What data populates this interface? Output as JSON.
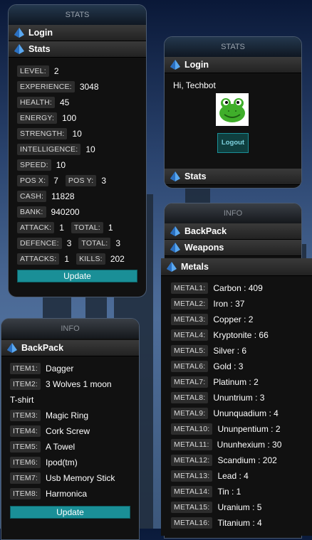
{
  "colors": {
    "accent": "#1a8f97",
    "panel": "#111111"
  },
  "stats_panel": {
    "header": "STATS",
    "login_label": "Login",
    "stats_label": "Stats",
    "level": {
      "label": "LEVEL:",
      "value": "2"
    },
    "experience": {
      "label": "EXPERIENCE:",
      "value": "3048"
    },
    "health": {
      "label": "HEALTH:",
      "value": "45"
    },
    "energy": {
      "label": "ENERGY:",
      "value": "100"
    },
    "strength": {
      "label": "STRENGTH:",
      "value": "10"
    },
    "intelligence": {
      "label": "INTELLIGENCE:",
      "value": "10"
    },
    "speed": {
      "label": "SPEED:",
      "value": "10"
    },
    "posx": {
      "label": "POS X:",
      "value": "7"
    },
    "posy": {
      "label": "POS Y:",
      "value": "3"
    },
    "cash": {
      "label": "CASH:",
      "value": "11828"
    },
    "bank": {
      "label": "BANK:",
      "value": "940200"
    },
    "attack": {
      "label": "ATTACK:",
      "value": "1"
    },
    "attack_total": {
      "label": "TOTAL:",
      "value": "1"
    },
    "defence": {
      "label": "DEFENCE:",
      "value": "3"
    },
    "defence_total": {
      "label": "TOTAL:",
      "value": "3"
    },
    "attacks": {
      "label": "ATTACKS:",
      "value": "1"
    },
    "kills": {
      "label": "KILLS:",
      "value": "202"
    },
    "update_label": "Update"
  },
  "login_panel": {
    "header": "STATS",
    "login_label": "Login",
    "greeting": "Hi, Techbot",
    "logout_label": "Logout",
    "stats_label": "Stats",
    "avatar_icon": "frog-avatar"
  },
  "info_panel_right": {
    "header": "INFO",
    "backpack_label": "BackPack",
    "weapons_label": "Weapons",
    "metals_label": "Metals",
    "metals": [
      {
        "label": "METAL1:",
        "value": "Carbon : 409"
      },
      {
        "label": "METAL2:",
        "value": "Iron : 37"
      },
      {
        "label": "METAL3:",
        "value": "Copper : 2"
      },
      {
        "label": "METAL4:",
        "value": "Kryptonite : 66"
      },
      {
        "label": "METAL5:",
        "value": "Silver : 6"
      },
      {
        "label": "METAL6:",
        "value": "Gold : 3"
      },
      {
        "label": "METAL7:",
        "value": "Platinum : 2"
      },
      {
        "label": "METAL8:",
        "value": "Ununtrium : 3"
      },
      {
        "label": "METAL9:",
        "value": "Ununquadium : 4"
      },
      {
        "label": "METAL10:",
        "value": "Ununpentium : 2"
      },
      {
        "label": "METAL11:",
        "value": "Ununhexium : 30"
      },
      {
        "label": "METAL12:",
        "value": "Scandium : 202"
      },
      {
        "label": "METAL13:",
        "value": "Lead : 4"
      },
      {
        "label": "METAL14:",
        "value": "Tin : 1"
      },
      {
        "label": "METAL15:",
        "value": "Uranium : 5"
      },
      {
        "label": "METAL16:",
        "value": "Titanium : 4"
      }
    ]
  },
  "info_panel_left": {
    "header": "INFO",
    "backpack_label": "BackPack",
    "items": [
      {
        "label": "ITEM1:",
        "value": "Dagger"
      },
      {
        "label": "ITEM2:",
        "value": "3 Wolves 1 moon",
        "wrap": "T-shirt"
      },
      {
        "label": "ITEM3:",
        "value": "Magic Ring"
      },
      {
        "label": "ITEM4:",
        "value": "Cork Screw"
      },
      {
        "label": "ITEM5:",
        "value": "A Towel"
      },
      {
        "label": "ITEM6:",
        "value": "Ipod(tm)"
      },
      {
        "label": "ITEM7:",
        "value": "Usb Memory Stick"
      },
      {
        "label": "ITEM8:",
        "value": "Harmonica"
      }
    ],
    "update_label": "Update"
  }
}
